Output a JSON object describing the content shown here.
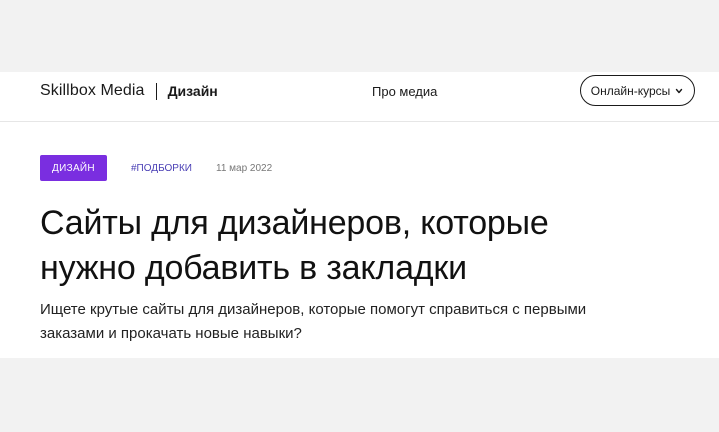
{
  "header": {
    "brand": "Skillbox Media",
    "section": "Дизайн",
    "nav_about": "Про медиа",
    "courses_label": "Онлайн-курсы",
    "courses_icon": "chevron-down-icon"
  },
  "article": {
    "category_badge": "ДИЗАЙН",
    "tag": "#ПОДБОРКИ",
    "date": "11 мар 2022",
    "title_line1": "Сайты для дизайнеров, которые",
    "title_line2": "нужно добавить в закладки",
    "lead_line1": "Ищете крутые сайты для дизайнеров, которые помогут справиться с первыми",
    "lead_line2": "заказами и прокачать новые навыки?"
  },
  "colors": {
    "accent": "#7a2ee0",
    "tag": "#4a3fb5",
    "page_background": "#f2f2f2",
    "surface": "#ffffff",
    "text": "#111111"
  }
}
